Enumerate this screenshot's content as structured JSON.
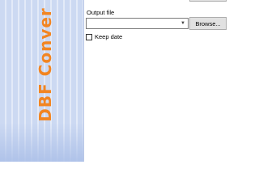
{
  "banner": {
    "text": "DBF Conver"
  },
  "output": {
    "label": "Output file",
    "value": "",
    "browse_label": "Browse..."
  },
  "options": {
    "keep_date_label": "Keep date",
    "keep_date_checked": false
  },
  "colors": {
    "banner_bg": "#ccd9f2",
    "banner_text": "#f28522"
  },
  "icons": {
    "combo_arrow": "chevron-down-icon"
  }
}
